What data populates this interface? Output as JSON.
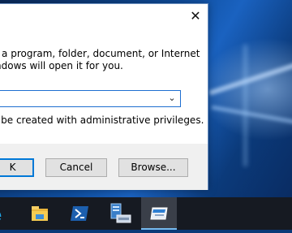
{
  "dialog": {
    "close_symbol": "✕",
    "description_line1": "f a program, folder, document, or Internet",
    "description_line2": "ndows will open it for you.",
    "open_value": "",
    "dropdown_symbol": "⌄",
    "admin_note": "l be created with administrative privileges.",
    "buttons": {
      "ok": "K",
      "cancel": "Cancel",
      "browse": "Browse..."
    }
  },
  "taskbar": {
    "items": [
      {
        "icon": "internet-explorer-icon"
      },
      {
        "icon": "file-explorer-icon"
      },
      {
        "icon": "powershell-icon"
      },
      {
        "icon": "server-manager-icon"
      },
      {
        "icon": "run-dialog-icon",
        "active": true
      }
    ],
    "ie_glyph": "e"
  },
  "colors": {
    "accent": "#0078d7",
    "taskbar": "#161a22",
    "active_indicator": "#76b9ed"
  }
}
